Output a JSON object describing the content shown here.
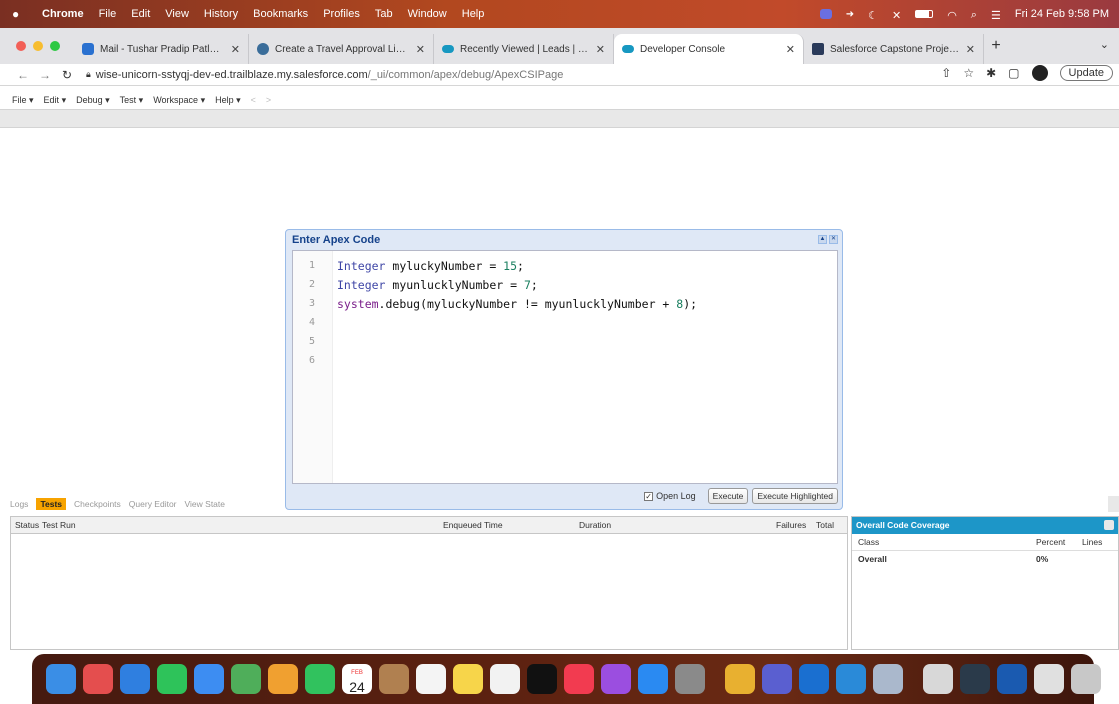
{
  "menubar": {
    "items": [
      "Chrome",
      "File",
      "Edit",
      "View",
      "History",
      "Bookmarks",
      "Profiles",
      "Tab",
      "Window",
      "Help"
    ],
    "datetime": "Fri 24 Feb  9:58 PM"
  },
  "tabs": [
    {
      "label": "Mail - Tushar Pradip Patle - Ou",
      "icon": "outlook-icon",
      "color": "#2a71d0",
      "active": false
    },
    {
      "label": "Create a Travel Approval Lighti",
      "icon": "trailhead-icon",
      "color": "#3a6d9a",
      "active": false
    },
    {
      "label": "Recently Viewed | Leads | Sale",
      "icon": "salesforce-cloud-icon",
      "color": "#1798c1",
      "active": false
    },
    {
      "label": "Developer Console",
      "icon": "salesforce-cloud-icon",
      "color": "#1798c1",
      "active": true
    },
    {
      "label": "Salesforce Capstone Project -",
      "icon": "docs-icon",
      "color": "#2a3a5a",
      "active": false
    }
  ],
  "addressbar": {
    "domain": "wise-unicorn-sstyqj-dev-ed.trailblaze.my.salesforce.com",
    "path": "/_ui/common/apex/debug/ApexCSIPage",
    "update_label": "Update"
  },
  "devconsole_menu": [
    "File",
    "Edit",
    "Debug",
    "Test",
    "Workspace",
    "Help"
  ],
  "modal": {
    "title": "Enter Apex Code",
    "lines": [
      {
        "n": "1",
        "code": [
          {
            "t": "Integer",
            "c": "kw"
          },
          {
            "t": " myluckyNumber = ",
            "c": ""
          },
          {
            "t": "15",
            "c": "num"
          },
          {
            "t": ";",
            "c": ""
          }
        ]
      },
      {
        "n": "2",
        "code": [
          {
            "t": "Integer",
            "c": "kw"
          },
          {
            "t": " myunlucklyNumber = ",
            "c": ""
          },
          {
            "t": "7",
            "c": "num"
          },
          {
            "t": ";",
            "c": ""
          }
        ]
      },
      {
        "n": "3",
        "code": [
          {
            "t": "system",
            "c": "sys"
          },
          {
            "t": ".debug(myluckyNumber != myunlucklyNumber + ",
            "c": ""
          },
          {
            "t": "8",
            "c": "num"
          },
          {
            "t": ");",
            "c": ""
          }
        ]
      },
      {
        "n": "4",
        "code": []
      },
      {
        "n": "5",
        "code": []
      },
      {
        "n": "6",
        "code": []
      }
    ],
    "open_log_label": "Open Log",
    "open_log_checked": true,
    "execute_label": "Execute",
    "execute_highlighted_label": "Execute Highlighted"
  },
  "bottom_tabs": [
    "Logs",
    "Tests",
    "Checkpoints",
    "Query Editor",
    "View State"
  ],
  "bottom_active_tab": "Tests",
  "tests_table": {
    "columns": [
      "Status",
      "Test Run",
      "Enqueued Time",
      "Duration",
      "Failures",
      "Total"
    ]
  },
  "coverage": {
    "title": "Overall Code Coverage",
    "columns": [
      "Class",
      "Percent",
      "Lines"
    ],
    "rows": [
      {
        "class": "Overall",
        "percent": "0%",
        "lines": ""
      }
    ]
  },
  "dock": {
    "calendar_day": "24",
    "calendar_month": "FEB",
    "apps": [
      {
        "name": "finder-icon",
        "color": "#3a8ee6"
      },
      {
        "name": "launchpad-icon",
        "color": "#e44e4e"
      },
      {
        "name": "safari-icon",
        "color": "#2f7fe0"
      },
      {
        "name": "messages-icon",
        "color": "#2ec35a"
      },
      {
        "name": "mail-icon",
        "color": "#3d8df2"
      },
      {
        "name": "maps-icon",
        "color": "#4fae5a"
      },
      {
        "name": "photos-icon",
        "color": "#f0a030"
      },
      {
        "name": "facetime-icon",
        "color": "#31c25e"
      },
      {
        "name": "calendar-icon",
        "color": "#ffffff"
      },
      {
        "name": "contacts-icon",
        "color": "#b08050"
      },
      {
        "name": "reminders-icon",
        "color": "#f4f4f4"
      },
      {
        "name": "notes-icon",
        "color": "#f7d54a"
      },
      {
        "name": "freeform-icon",
        "color": "#f2f2f2"
      },
      {
        "name": "tv-icon",
        "color": "#111111"
      },
      {
        "name": "music-icon",
        "color": "#f23b50"
      },
      {
        "name": "podcasts-icon",
        "color": "#9b4ee0"
      },
      {
        "name": "app-store-icon",
        "color": "#2a8af2"
      },
      {
        "name": "system-settings-icon",
        "color": "#8a8a8a"
      },
      {
        "name": "chrome-icon",
        "color": "#e8b030"
      },
      {
        "name": "teams-icon",
        "color": "#5a5fd0"
      },
      {
        "name": "outlook-icon",
        "color": "#1a6fd0"
      },
      {
        "name": "vscode-icon",
        "color": "#2a8ad8"
      },
      {
        "name": "preview-icon",
        "color": "#aab8cc"
      },
      {
        "name": "downloads-icon",
        "color": "#d8d8d8"
      },
      {
        "name": "window-thumbnail-icon",
        "color": "#2a3a4a"
      },
      {
        "name": "window-thumbnail-icon",
        "color": "#1a5ab0"
      },
      {
        "name": "window-thumbnail-icon",
        "color": "#e0e0e0"
      },
      {
        "name": "trash-icon",
        "color": "#c8c8c8"
      }
    ]
  }
}
